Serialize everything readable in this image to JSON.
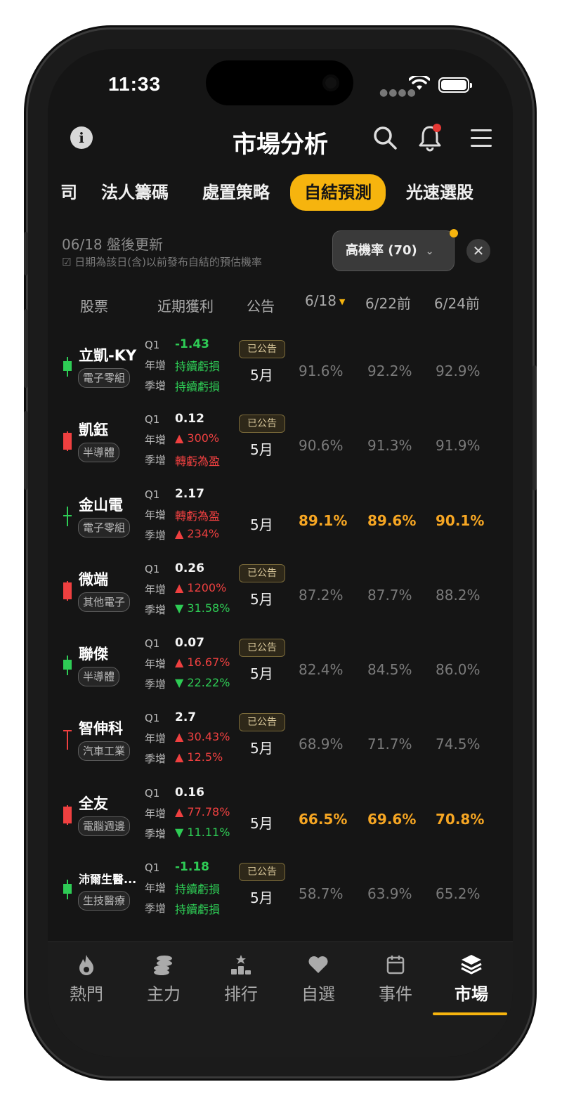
{
  "status": {
    "time": "11:33"
  },
  "header": {
    "title": "市場分析"
  },
  "tabs": [
    {
      "label": "司"
    },
    {
      "label": "法人籌碼"
    },
    {
      "label": "處置策略"
    },
    {
      "label": "自結預測"
    },
    {
      "label": "光速選股"
    }
  ],
  "update": {
    "date": "06/18 盤後更新",
    "note": "☑ 日期為該日(含)以前發布自結的預估機率"
  },
  "filter": {
    "label": "高機率 (70)",
    "chevron": "⌄",
    "close": "✕"
  },
  "columns": {
    "stock": "股票",
    "recent_profit": "近期獲利",
    "announcement": "公告",
    "d1": "6/18",
    "d2": "6/22前",
    "d3": "6/24前"
  },
  "labels": {
    "q1": "Q1",
    "yoy": "年增",
    "qoq": "季增"
  },
  "colors": {
    "accent": "#f6b40e",
    "up": "#ef4040",
    "down": "#2ecc55"
  },
  "rows": [
    {
      "name": "立凱-KY",
      "industry": "電子零組",
      "q1": "-1.43",
      "q1_color": "green",
      "yoy": "持續虧損",
      "yoy_color": "green",
      "qoq": "持續虧損",
      "qoq_color": "green",
      "announced": "已公告",
      "month": "5月",
      "p1": "91.6%",
      "p2": "92.2%",
      "p3": "92.9%",
      "highlight": false,
      "candle": "green"
    },
    {
      "name": "凱鈺",
      "industry": "半導體",
      "q1": "0.12",
      "q1_color": "white",
      "yoy": "▲ 300%",
      "yoy_color": "red",
      "qoq": "轉虧為盈",
      "qoq_color": "red",
      "announced": "已公告",
      "month": "5月",
      "p1": "90.6%",
      "p2": "91.3%",
      "p3": "91.9%",
      "highlight": false,
      "candle": "red"
    },
    {
      "name": "金山電",
      "industry": "電子零組",
      "q1": "2.17",
      "q1_color": "white",
      "yoy": "轉虧為盈",
      "yoy_color": "red",
      "qoq": "▲ 234%",
      "qoq_color": "red",
      "announced": "",
      "month": "5月",
      "p1": "89.1%",
      "p2": "89.6%",
      "p3": "90.1%",
      "highlight": true,
      "candle": "green-cross"
    },
    {
      "name": "微端",
      "industry": "其他電子",
      "q1": "0.26",
      "q1_color": "white",
      "yoy": "▲ 1200%",
      "yoy_color": "red",
      "qoq": "▼ 31.58%",
      "qoq_color": "green",
      "announced": "已公告",
      "month": "5月",
      "p1": "87.2%",
      "p2": "87.7%",
      "p3": "88.2%",
      "highlight": false,
      "candle": "red"
    },
    {
      "name": "聯傑",
      "industry": "半導體",
      "q1": "0.07",
      "q1_color": "white",
      "yoy": "▲ 16.67%",
      "yoy_color": "red",
      "qoq": "▼ 22.22%",
      "qoq_color": "green",
      "announced": "已公告",
      "month": "5月",
      "p1": "82.4%",
      "p2": "84.5%",
      "p3": "86.0%",
      "highlight": false,
      "candle": "green"
    },
    {
      "name": "智伸科",
      "industry": "汽車工業",
      "q1": "2.7",
      "q1_color": "white",
      "yoy": "▲ 30.43%",
      "yoy_color": "red",
      "qoq": "▲ 12.5%",
      "qoq_color": "red",
      "announced": "已公告",
      "month": "5月",
      "p1": "68.9%",
      "p2": "71.7%",
      "p3": "74.5%",
      "highlight": false,
      "candle": "red-t"
    },
    {
      "name": "全友",
      "industry": "電腦週邊",
      "q1": "0.16",
      "q1_color": "white",
      "yoy": "▲ 77.78%",
      "yoy_color": "red",
      "qoq": "▼ 11.11%",
      "qoq_color": "green",
      "announced": "",
      "month": "5月",
      "p1": "66.5%",
      "p2": "69.6%",
      "p3": "70.8%",
      "highlight": true,
      "candle": "red"
    },
    {
      "name": "沛爾生醫...",
      "industry": "生技醫療",
      "q1": "-1.18",
      "q1_color": "green",
      "yoy": "持續虧損",
      "yoy_color": "green",
      "qoq": "持續虧損",
      "qoq_color": "green",
      "announced": "已公告",
      "month": "5月",
      "p1": "58.7%",
      "p2": "63.9%",
      "p3": "65.2%",
      "highlight": false,
      "candle": "green"
    }
  ],
  "bottom_nav": [
    {
      "label": "熱門",
      "icon": "flame-icon"
    },
    {
      "label": "主力",
      "icon": "coins-icon"
    },
    {
      "label": "排行",
      "icon": "podium-icon"
    },
    {
      "label": "自選",
      "icon": "heart-icon"
    },
    {
      "label": "事件",
      "icon": "calendar-icon"
    },
    {
      "label": "市場",
      "icon": "layers-icon",
      "active": true
    }
  ]
}
